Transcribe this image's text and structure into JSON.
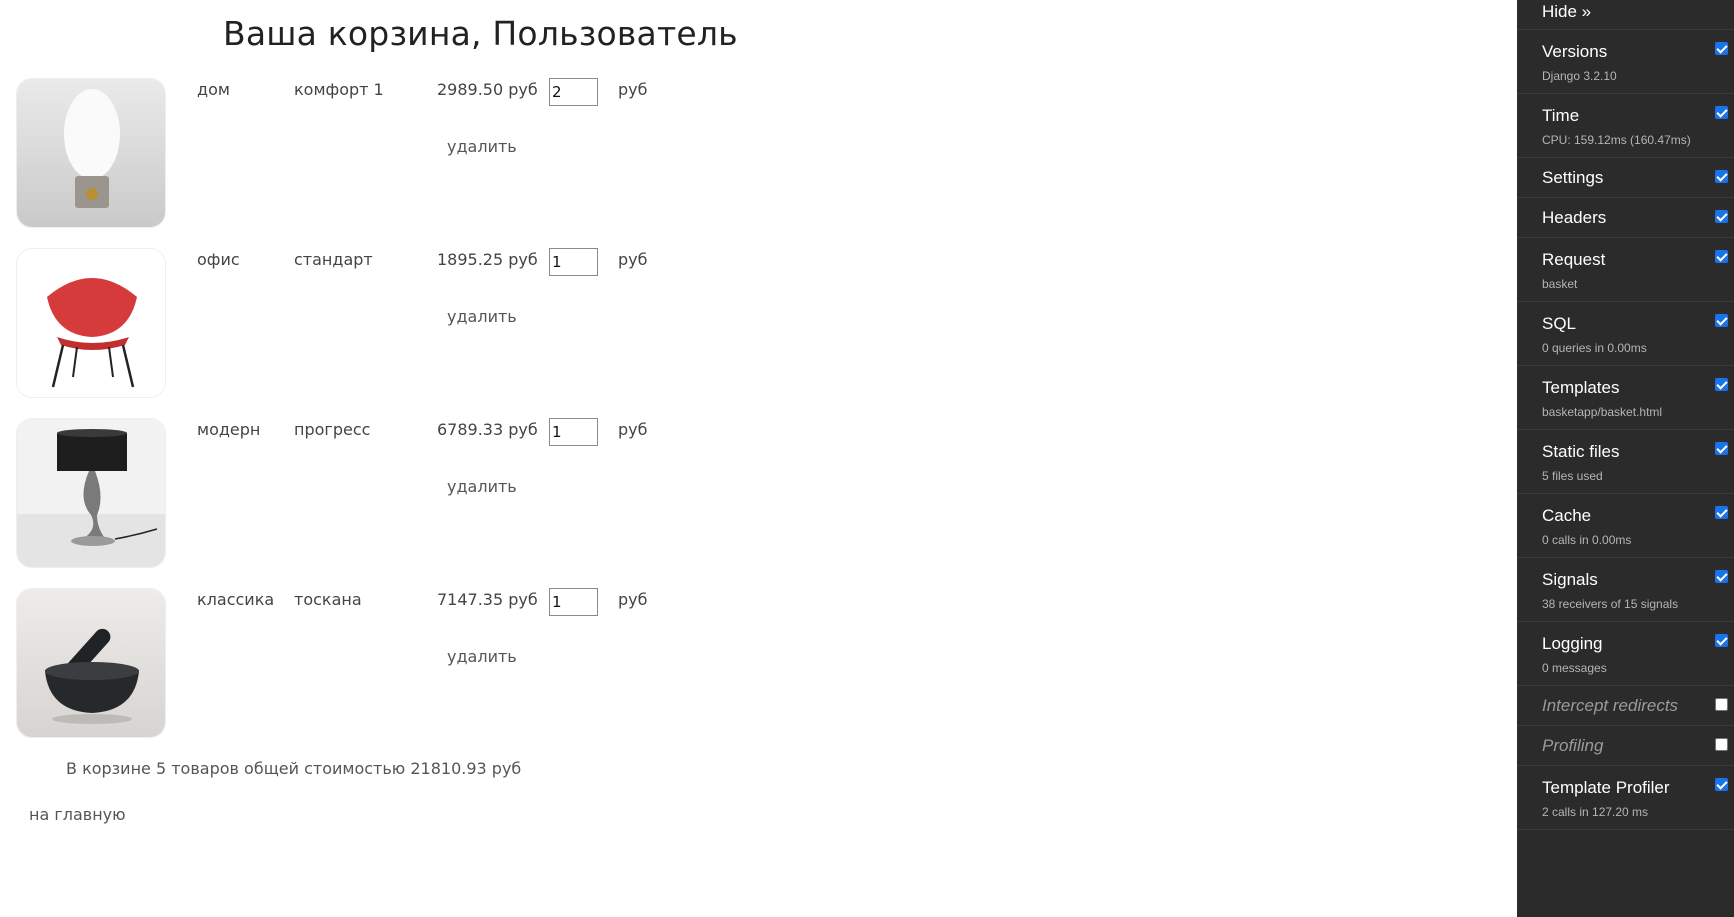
{
  "page": {
    "title": "Ваша корзина, Пользователь"
  },
  "basket": {
    "items": [
      {
        "category": "дом",
        "name": "комфорт 1",
        "price": "2989.50 руб",
        "quantity": "2",
        "currency": "руб",
        "delete_label": "удалить",
        "image_icon": "egg-lamp-icon"
      },
      {
        "category": "офис",
        "name": "стандарт",
        "price": "1895.25 руб",
        "quantity": "1",
        "currency": "руб",
        "delete_label": "удалить",
        "image_icon": "red-chair-icon"
      },
      {
        "category": "модерн",
        "name": "прогресс",
        "price": "6789.33 руб",
        "quantity": "1",
        "currency": "руб",
        "delete_label": "удалить",
        "image_icon": "black-table-lamp-icon"
      },
      {
        "category": "классика",
        "name": "тоскана",
        "price": "7147.35 руб",
        "quantity": "1",
        "currency": "руб",
        "delete_label": "удалить",
        "image_icon": "mortar-pestle-icon"
      }
    ],
    "summary": "В корзине 5 товаров общей стоимостью 21810.93 руб",
    "home_link": "на главную"
  },
  "toolbar": {
    "hide_label": "Hide »",
    "panels": [
      {
        "title": "Versions",
        "subtitle": "Django 3.2.10",
        "checked": true
      },
      {
        "title": "Time",
        "subtitle": "CPU: 159.12ms (160.47ms)",
        "checked": true
      },
      {
        "title": "Settings",
        "subtitle": "",
        "checked": true
      },
      {
        "title": "Headers",
        "subtitle": "",
        "checked": true
      },
      {
        "title": "Request",
        "subtitle": "basket",
        "checked": true
      },
      {
        "title": "SQL",
        "subtitle": "0 queries in 0.00ms",
        "checked": true
      },
      {
        "title": "Templates",
        "subtitle": "basketapp/basket.html",
        "checked": true
      },
      {
        "title": "Static files",
        "subtitle": "5 files used",
        "checked": true
      },
      {
        "title": "Cache",
        "subtitle": "0 calls in 0.00ms",
        "checked": true
      },
      {
        "title": "Signals",
        "subtitle": "38 receivers of 15 signals",
        "checked": true
      },
      {
        "title": "Logging",
        "subtitle": "0 messages",
        "checked": true
      },
      {
        "title": "Intercept redirects",
        "subtitle": "",
        "checked": false
      },
      {
        "title": "Profiling",
        "subtitle": "",
        "checked": false
      },
      {
        "title": "Template Profiler",
        "subtitle": "2 calls in 127.20 ms",
        "checked": true
      }
    ],
    "colors": {
      "background": "#2b2b2b",
      "checkbox": "#1a73e8"
    }
  }
}
